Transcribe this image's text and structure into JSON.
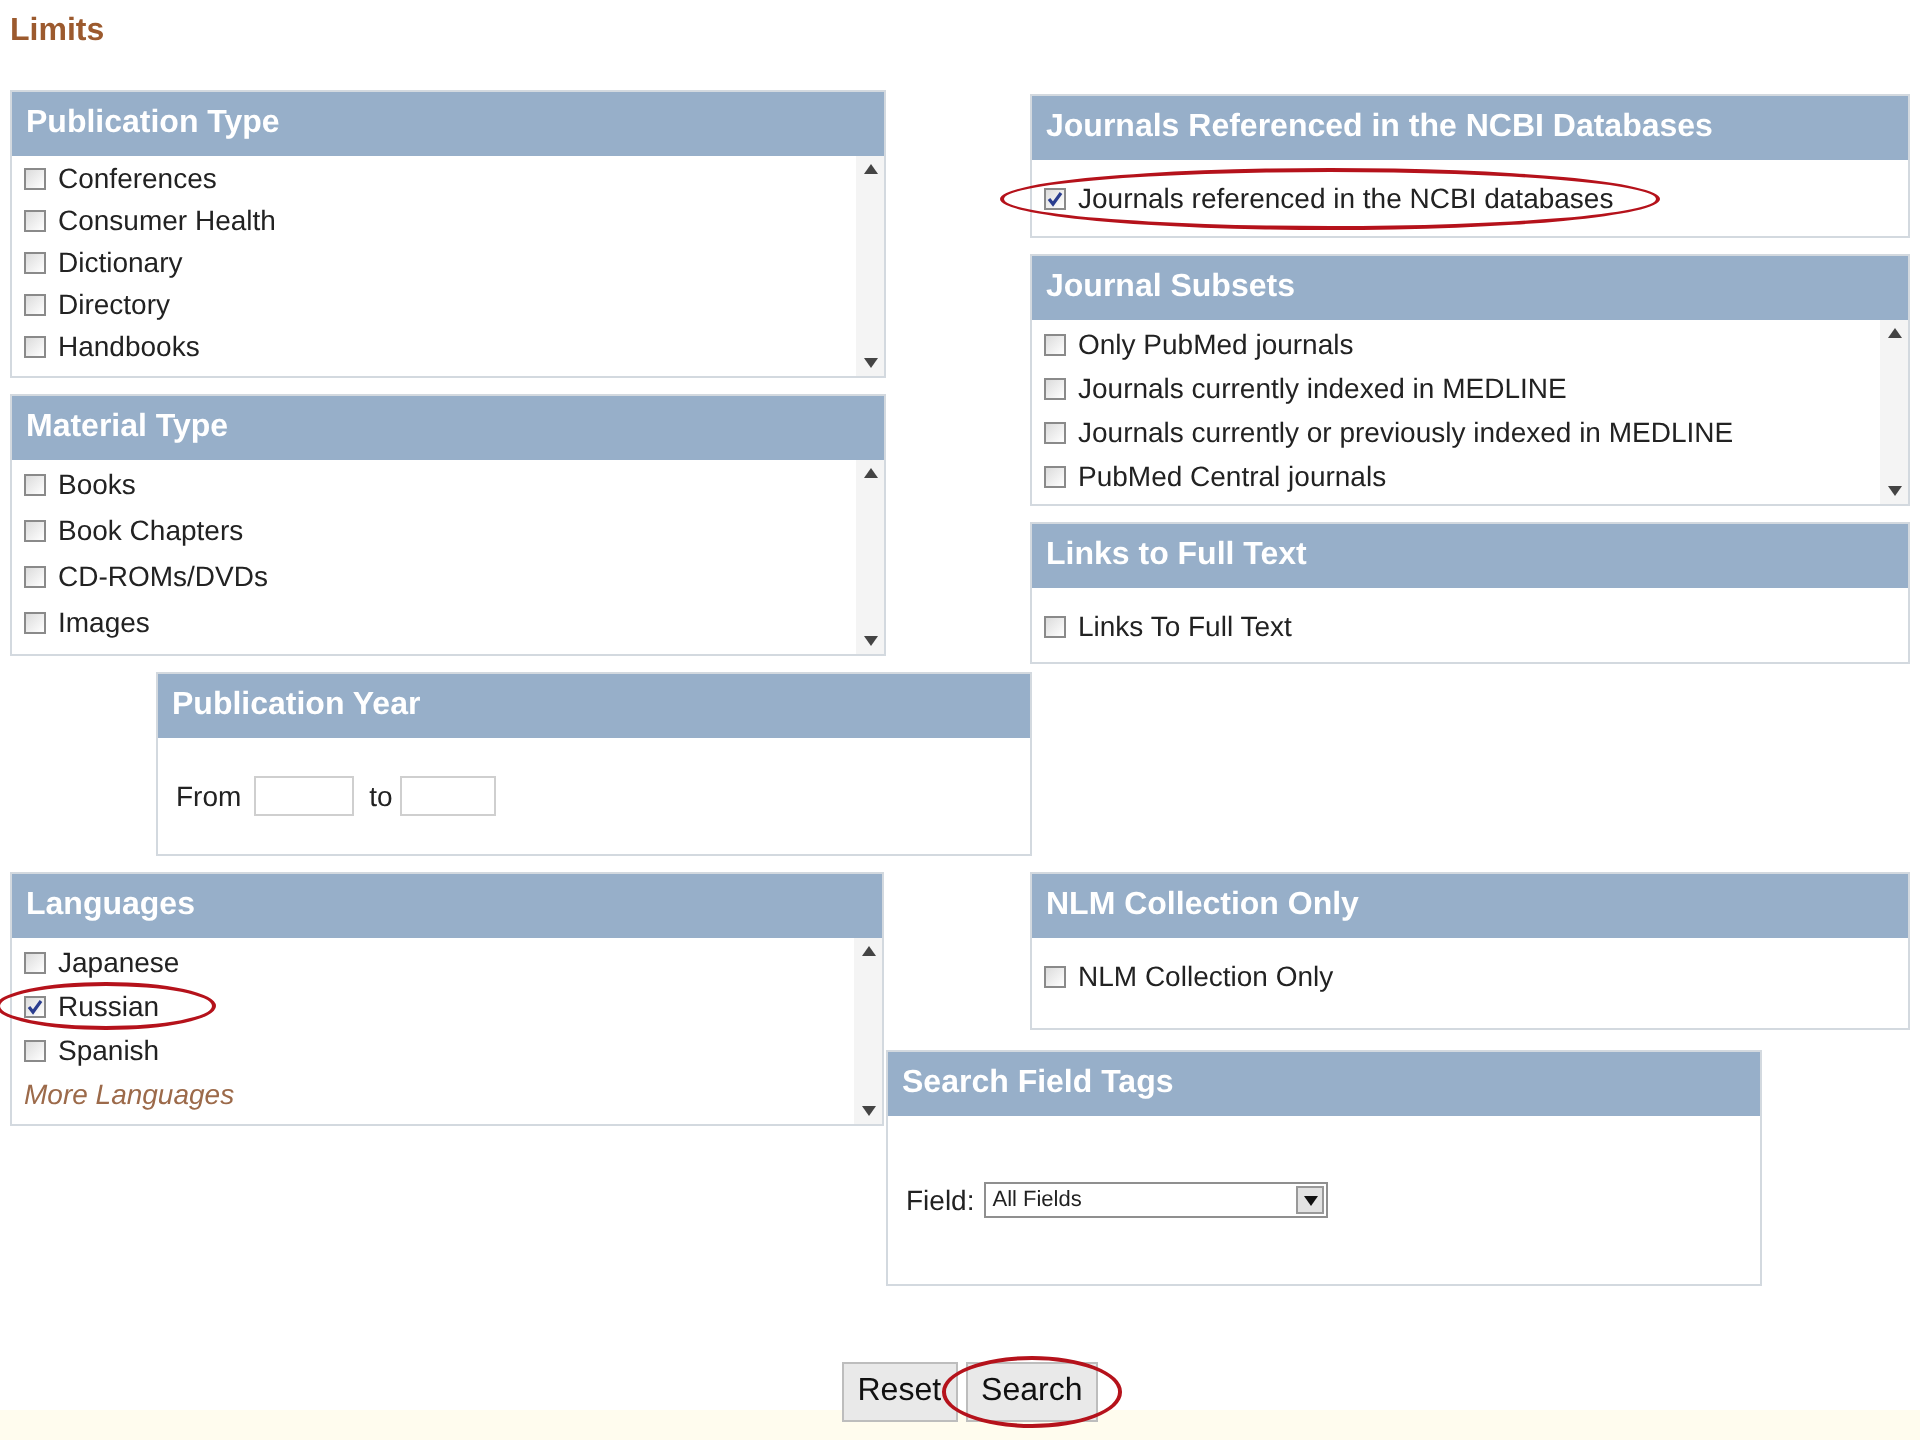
{
  "title": "Limits",
  "panels": [
    {
      "kind": "checklist",
      "title": "Publication Type",
      "scrollable": true,
      "items": [
        {
          "kind": "checkbox",
          "label": "Conferences",
          "checked": false,
          "circled": false
        },
        {
          "kind": "checkbox",
          "label": "Consumer Health",
          "checked": false,
          "circled": false
        },
        {
          "kind": "checkbox",
          "label": "Dictionary",
          "checked": false,
          "circled": false
        },
        {
          "kind": "checkbox",
          "label": "Directory",
          "checked": false,
          "circled": false
        },
        {
          "kind": "checkbox",
          "label": "Handbooks",
          "checked": false,
          "circled": false
        }
      ]
    },
    {
      "kind": "checklist",
      "title": "Material Type",
      "scrollable": true,
      "items": [
        {
          "kind": "checkbox",
          "label": "Books",
          "checked": false,
          "circled": false
        },
        {
          "kind": "checkbox",
          "label": "Book Chapters",
          "checked": false,
          "circled": false
        },
        {
          "kind": "checkbox",
          "label": "CD-ROMs/DVDs",
          "checked": false,
          "circled": false
        },
        {
          "kind": "checkbox",
          "label": "Images",
          "checked": false,
          "circled": false
        }
      ]
    },
    {
      "kind": "checklist",
      "title": "Journals Referenced in the NCBI Databases",
      "scrollable": false,
      "items": [
        {
          "kind": "checkbox",
          "label": "Journals referenced in the NCBI databases",
          "checked": true,
          "circled": true
        }
      ]
    },
    {
      "kind": "checklist",
      "title": "Journal Subsets",
      "scrollable": true,
      "items": [
        {
          "kind": "checkbox",
          "label": "Only PubMed journals",
          "checked": false,
          "circled": false
        },
        {
          "kind": "checkbox",
          "label": "Journals currently indexed in MEDLINE",
          "checked": false,
          "circled": false
        },
        {
          "kind": "checkbox",
          "label": "Journals currently or previously indexed in MEDLINE",
          "checked": false,
          "circled": false
        },
        {
          "kind": "checkbox",
          "label": "PubMed Central journals",
          "checked": false,
          "circled": false
        }
      ]
    },
    {
      "kind": "checklist",
      "title": "Links to Full Text",
      "scrollable": false,
      "items": [
        {
          "kind": "checkbox",
          "label": "Links To Full Text",
          "checked": false,
          "circled": false
        }
      ]
    },
    {
      "kind": "year",
      "title": "Publication Year",
      "from_label": "From",
      "to_label": "to"
    },
    {
      "kind": "checklist",
      "title": "Languages",
      "scrollable": true,
      "items": [
        {
          "kind": "checkbox",
          "label": "Japanese",
          "checked": false,
          "circled": false
        },
        {
          "kind": "checkbox",
          "label": "Russian",
          "checked": true,
          "circled": true
        },
        {
          "kind": "checkbox",
          "label": "Spanish",
          "checked": false,
          "circled": false
        },
        {
          "kind": "link",
          "label": "More Languages"
        }
      ]
    },
    {
      "kind": "checklist",
      "title": "NLM Collection Only",
      "scrollable": false,
      "items": [
        {
          "kind": "checkbox",
          "label": "NLM Collection Only",
          "checked": false,
          "circled": false
        }
      ]
    },
    {
      "kind": "select",
      "title": "Search Field Tags",
      "label": "Field:",
      "value": "All Fields"
    }
  ],
  "buttons": [
    {
      "label": "Reset",
      "circled": false
    },
    {
      "label": "Search",
      "circled": true
    }
  ]
}
